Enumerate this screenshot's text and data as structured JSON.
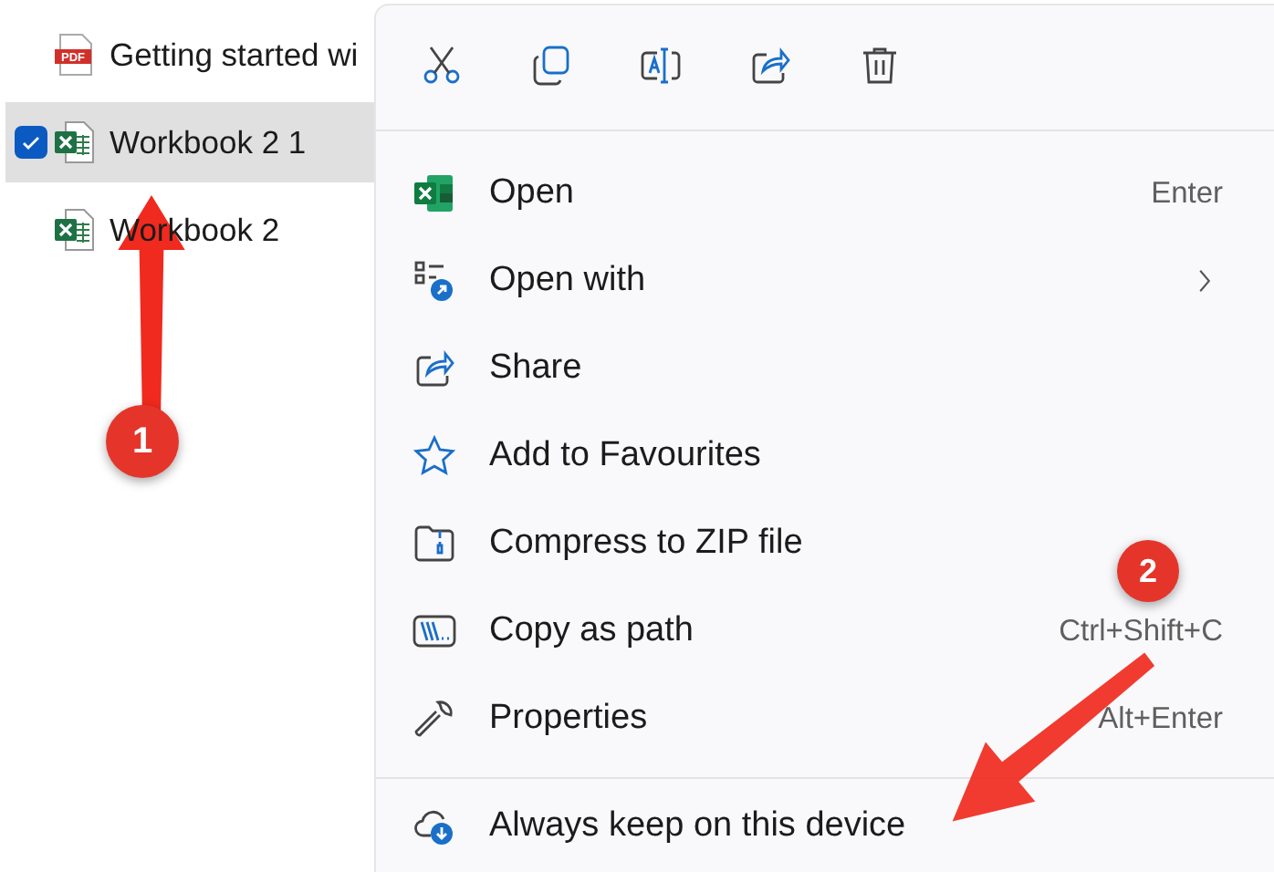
{
  "files": [
    {
      "name": "Getting started wi",
      "kind": "pdf",
      "icon_text": "PDF",
      "selected": false,
      "checked": false
    },
    {
      "name": "Workbook 2 1",
      "kind": "excel",
      "selected": true,
      "checked": true
    },
    {
      "name": "Workbook 2",
      "kind": "excel",
      "selected": false,
      "checked": false
    }
  ],
  "context_menu": {
    "items": [
      {
        "label": "Open",
        "shortcut": "Enter",
        "submenu": false
      },
      {
        "label": "Open with",
        "submenu": true
      },
      {
        "label": "Share",
        "submenu": false
      },
      {
        "label": "Add to Favourites",
        "submenu": false
      },
      {
        "label": "Compress to ZIP file",
        "submenu": false
      },
      {
        "label": "Copy as path",
        "shortcut": "Ctrl+Shift+C",
        "submenu": false
      },
      {
        "label": "Properties",
        "shortcut": "Alt+Enter",
        "submenu": false
      }
    ],
    "extra_items": [
      {
        "label": "Always keep on this device"
      }
    ]
  },
  "annotations": [
    {
      "number": "1"
    },
    {
      "number": "2"
    }
  ]
}
